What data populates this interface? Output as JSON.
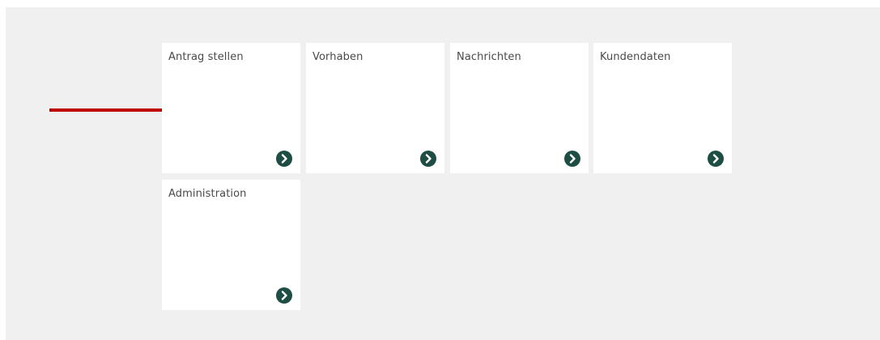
{
  "tiles": [
    {
      "label": "Antrag stellen",
      "action_icon": "chevron-right-circle-icon"
    },
    {
      "label": "Vorhaben",
      "action_icon": "chevron-right-circle-icon"
    },
    {
      "label": "Nachrichten",
      "action_icon": "chevron-right-circle-icon"
    },
    {
      "label": "Kundendaten",
      "action_icon": "chevron-right-circle-icon"
    },
    {
      "label": "Administration",
      "action_icon": "chevron-right-circle-icon"
    }
  ],
  "annotation": {
    "icon": "red-arrow-right-icon",
    "color": "#c00000"
  },
  "colors": {
    "background": "#f0f0f0",
    "tile": "#ffffff",
    "accent": "#1e4d44",
    "label": "#4a4a4a"
  }
}
